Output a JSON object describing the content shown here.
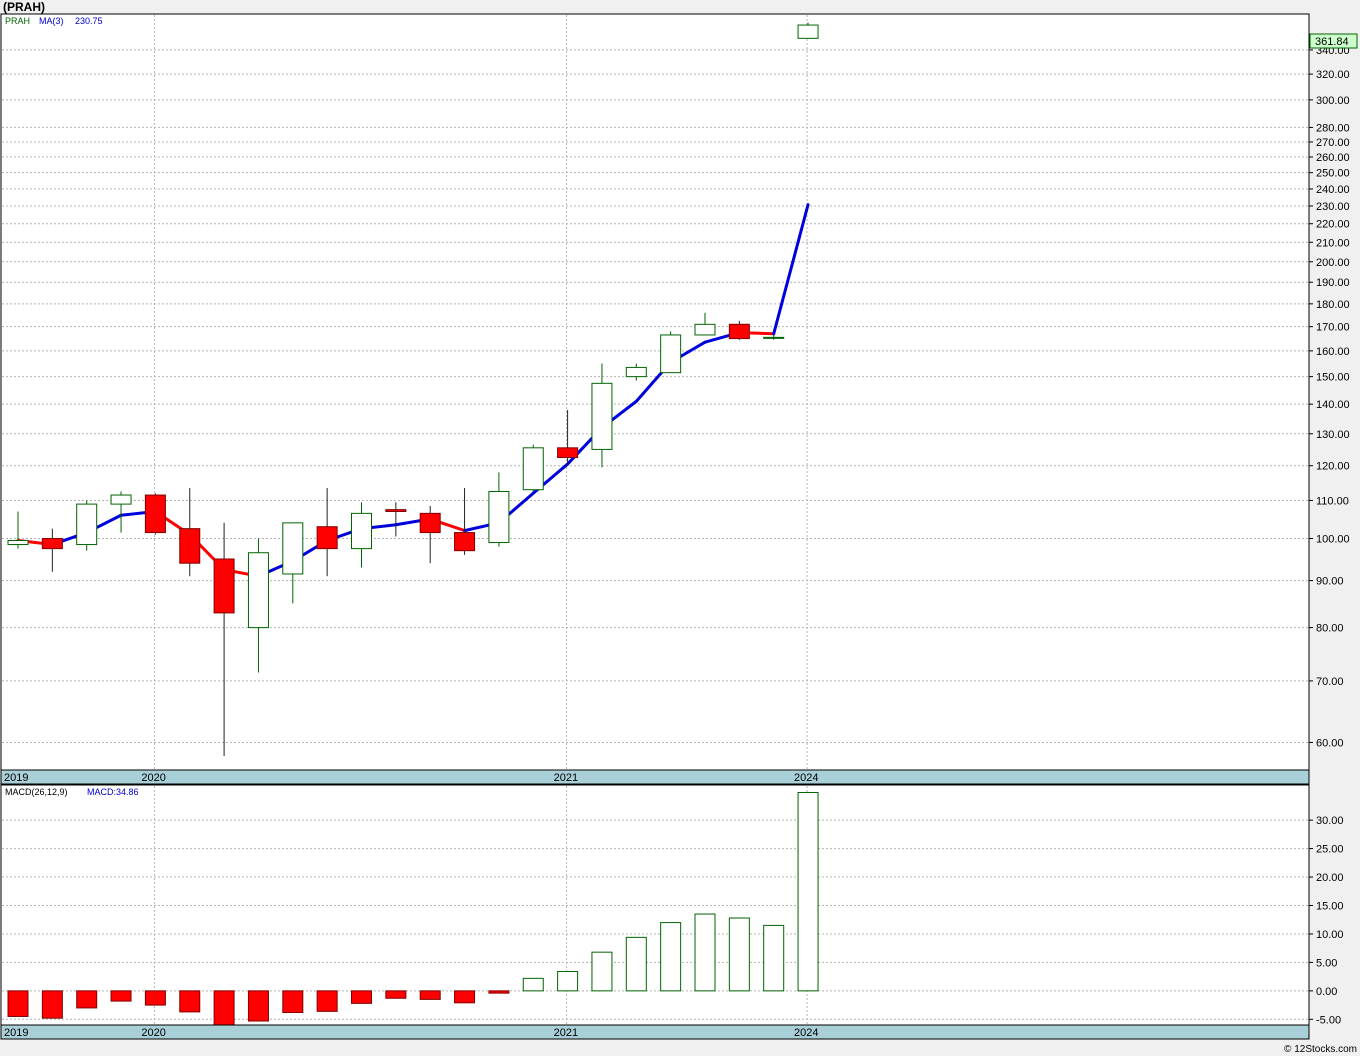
{
  "title": "(PRAH)",
  "footer": "© 12Stocks.com",
  "colors": {
    "up": "#006400",
    "down": "#ff0000",
    "ma": "#0000dd",
    "ma_down": "#ff0000",
    "grid": "#b4b4b4",
    "axis_band": "#a9cfd9",
    "last_price_bg": "#ccffcc"
  },
  "chart_data": [
    {
      "type": "candlestick",
      "ticker": "PRAH",
      "legend": {
        "ticker": "PRAH",
        "ma_label": "MA(3)",
        "ma_value": "230.75"
      },
      "y_scale": "log",
      "ylim": [
        56,
        372
      ],
      "y_ticks": [
        "60.00",
        "70.00",
        "80.00",
        "90.00",
        "100.00",
        "110.00",
        "120.00",
        "130.00",
        "140.00",
        "150.00",
        "160.00",
        "170.00",
        "180.00",
        "190.00",
        "200.00",
        "210.00",
        "220.00",
        "230.00",
        "240.00",
        "250.00",
        "260.00",
        "270.00",
        "280.00",
        "300.00",
        "320.00",
        "340.00"
      ],
      "last_price_label": "361.84",
      "x_tick_labels": [
        {
          "label": "2019",
          "index": 0
        },
        {
          "label": "2020",
          "index": 4
        },
        {
          "label": "2021",
          "index": 16
        },
        {
          "label": "2024",
          "index": 23
        }
      ],
      "candles": [
        {
          "o": 98.5,
          "h": 107,
          "l": 97.5,
          "c": 99.5
        },
        {
          "o": 100,
          "h": 102.5,
          "l": 92,
          "c": 97.5
        },
        {
          "o": 98.5,
          "h": 110,
          "l": 97,
          "c": 109
        },
        {
          "o": 109,
          "h": 112.5,
          "l": 101.5,
          "c": 111.5
        },
        {
          "o": 111.5,
          "h": 112,
          "l": 101,
          "c": 101.5
        },
        {
          "o": 102.5,
          "h": 113.5,
          "l": 91,
          "c": 94
        },
        {
          "o": 95,
          "h": 104,
          "l": 58,
          "c": 83
        },
        {
          "o": 80,
          "h": 100,
          "l": 71.5,
          "c": 96.5
        },
        {
          "o": 91.5,
          "h": 104,
          "l": 85,
          "c": 104
        },
        {
          "o": 103,
          "h": 113.5,
          "l": 91,
          "c": 97.5
        },
        {
          "o": 97.5,
          "h": 109.5,
          "l": 93,
          "c": 106.5
        },
        {
          "o": 107.5,
          "h": 109.5,
          "l": 100.5,
          "c": 107
        },
        {
          "o": 106.5,
          "h": 108.5,
          "l": 94,
          "c": 101.5
        },
        {
          "o": 101.5,
          "h": 113.5,
          "l": 96,
          "c": 97
        },
        {
          "o": 99,
          "h": 118,
          "l": 98,
          "c": 112.5
        },
        {
          "o": 113,
          "h": 126.5,
          "l": 112.5,
          "c": 125.5
        },
        {
          "o": 125.5,
          "h": 138,
          "l": 120,
          "c": 122.5
        },
        {
          "o": 125,
          "h": 155,
          "l": 119.5,
          "c": 147.5
        },
        {
          "o": 150,
          "h": 155,
          "l": 148.5,
          "c": 153.5
        },
        {
          "o": 151.5,
          "h": 168,
          "l": 151.5,
          "c": 166.5
        },
        {
          "o": 166.5,
          "h": 176,
          "l": 166.5,
          "c": 171
        },
        {
          "o": 171,
          "h": 172.5,
          "l": 164.5,
          "c": 165
        },
        {
          "o": 165.5,
          "h": 166.5,
          "l": 164.5,
          "c": 165.5
        },
        {
          "o": 350,
          "h": 364,
          "l": 350,
          "c": 361.84
        }
      ],
      "ma3": [
        99.5,
        98.5,
        101.5,
        106,
        107,
        101,
        92.5,
        91,
        94.5,
        99.5,
        102.5,
        103.5,
        105,
        102,
        104,
        112,
        120.5,
        132,
        141,
        155.5,
        163.5,
        167.5,
        167,
        230.75
      ]
    },
    {
      "type": "bar",
      "legend": {
        "name": "MACD(26,12,9)",
        "value_label": "MACD:34.86"
      },
      "ylim": [
        -6,
        36
      ],
      "y_ticks": [
        "-5.00",
        "0.00",
        "5.00",
        "10.00",
        "15.00",
        "20.00",
        "25.00",
        "30.00"
      ],
      "values": [
        -4.5,
        -4.8,
        -3.0,
        -1.8,
        -2.5,
        -3.7,
        -6.0,
        -5.3,
        -3.8,
        -3.6,
        -2.2,
        -1.3,
        -1.5,
        -2.1,
        -0.4,
        2.2,
        3.4,
        6.8,
        9.4,
        12.0,
        13.5,
        12.8,
        11.5,
        34.86
      ]
    }
  ]
}
